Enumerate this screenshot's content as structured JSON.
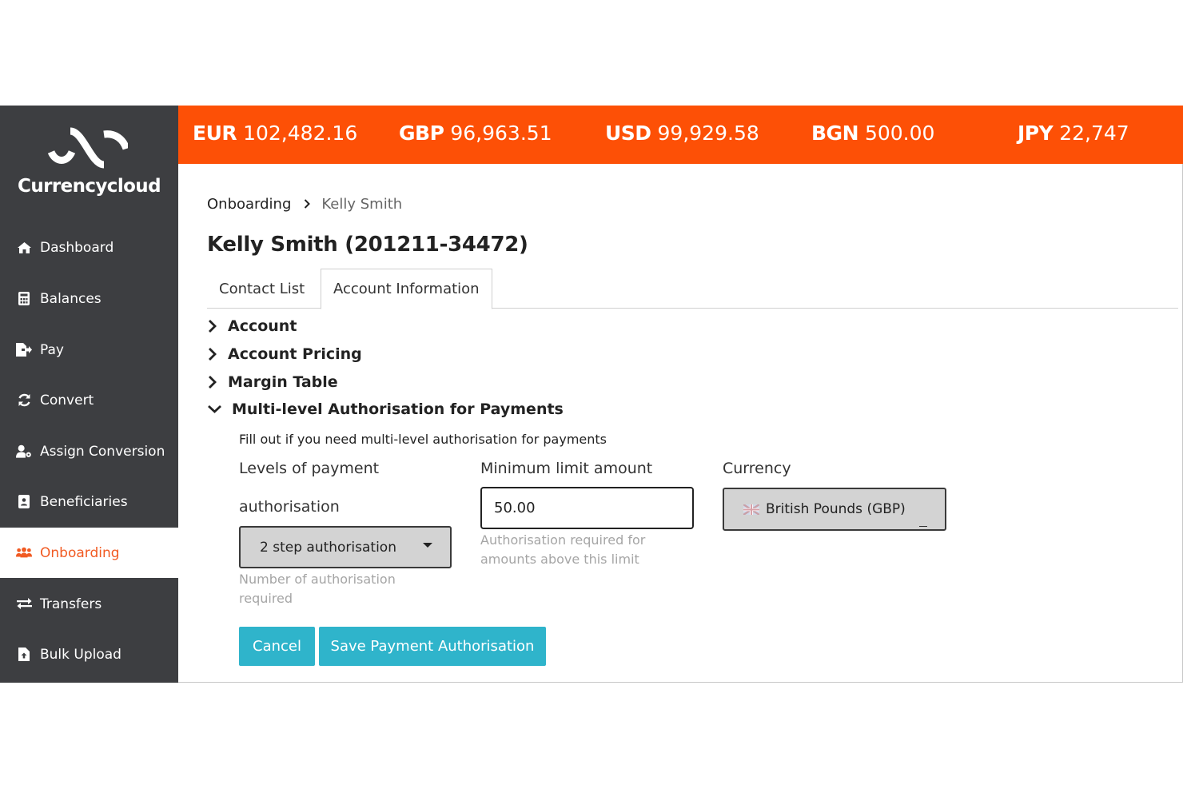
{
  "brand": {
    "name": "Currencycloud"
  },
  "balances": [
    {
      "code": "EUR",
      "amount": "102,482.16"
    },
    {
      "code": "GBP",
      "amount": "96,963.51"
    },
    {
      "code": "USD",
      "amount": "99,929.58"
    },
    {
      "code": "BGN",
      "amount": "500.00"
    },
    {
      "code": "JPY",
      "amount": "22,747"
    }
  ],
  "nav": [
    {
      "label": "Dashboard",
      "icon": "home-icon"
    },
    {
      "label": "Balances",
      "icon": "calculator-icon"
    },
    {
      "label": "Pay",
      "icon": "file-export-icon"
    },
    {
      "label": "Convert",
      "icon": "sync-icon"
    },
    {
      "label": "Assign Conversion",
      "icon": "user-cog-icon"
    },
    {
      "label": "Beneficiaries",
      "icon": "address-book-icon"
    },
    {
      "label": "Onboarding",
      "icon": "users-cog-icon",
      "active": true
    },
    {
      "label": "Transfers",
      "icon": "exchange-icon"
    },
    {
      "label": "Bulk Upload",
      "icon": "file-upload-icon"
    }
  ],
  "breadcrumb": {
    "parent": "Onboarding",
    "separator": "›",
    "current": "Kelly Smith"
  },
  "page_title": "Kelly Smith (201211-34472)",
  "tabs": [
    {
      "label": "Contact List",
      "active": false
    },
    {
      "label": "Account Information",
      "active": true
    }
  ],
  "sections": [
    {
      "label": "Account",
      "expanded": false
    },
    {
      "label": "Account Pricing",
      "expanded": false
    },
    {
      "label": "Margin Table",
      "expanded": false
    },
    {
      "label": "Multi-level Authorisation for Payments",
      "expanded": true
    }
  ],
  "auth_form": {
    "description": "Fill out if you need multi-level authorisation for payments",
    "levels_label_line1": "Levels of payment",
    "levels_label_line2": "authorisation",
    "levels_value": "2 step authorisation",
    "levels_help_line1": "Number of authorisation",
    "levels_help_line2": "required",
    "min_label": "Minimum limit amount",
    "min_value": "50.00",
    "min_help_line1": "Authorisation required for",
    "min_help_line2": "amounts above this limit",
    "currency_label": "Currency",
    "currency_value": "British Pounds (GBP)",
    "cancel_label": "Cancel",
    "save_label": "Save Payment Authorisation"
  },
  "colors": {
    "accent": "#fd5006",
    "sidebar": "#3d3e41",
    "button": "#2fb4cb"
  }
}
